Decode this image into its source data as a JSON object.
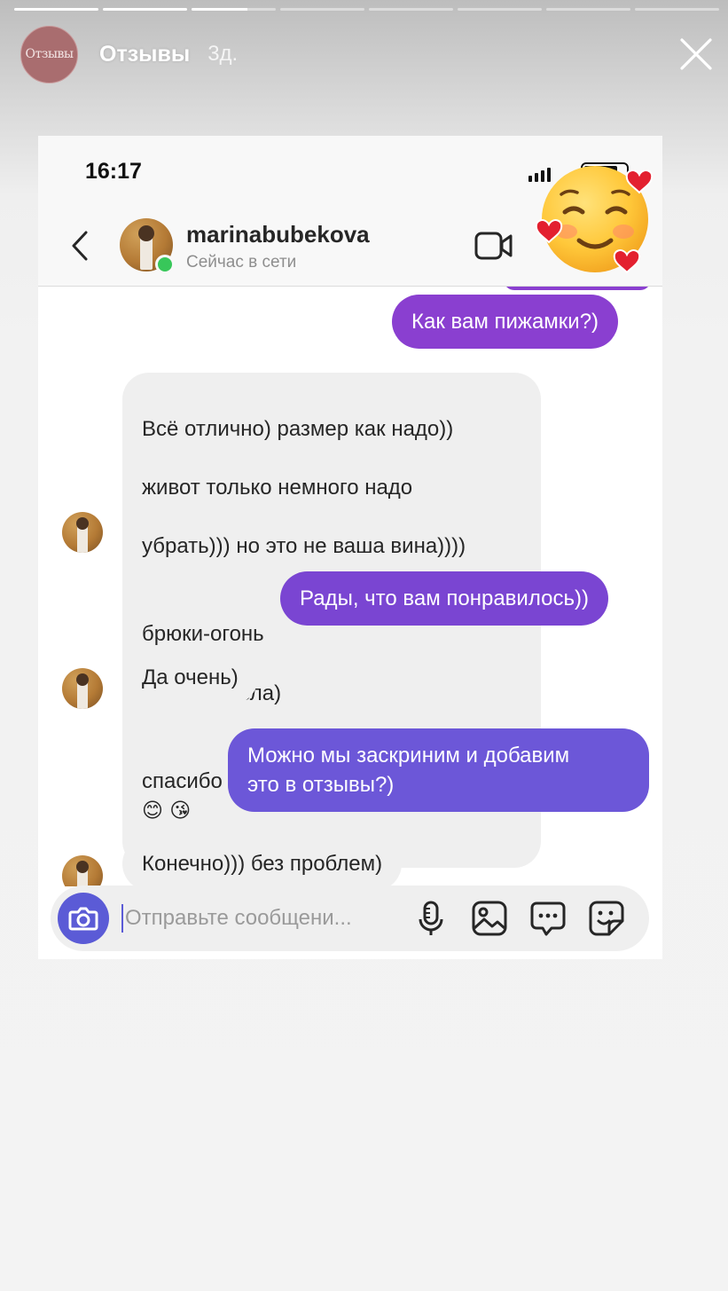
{
  "story": {
    "progress": [
      1,
      1,
      0.66,
      0,
      0,
      0,
      0,
      0
    ],
    "avatar_text": "Отзывы",
    "name": "Отзывы",
    "time": "3д.",
    "close_icon": "close-icon"
  },
  "screenshot": {
    "status_time": "16:17",
    "username": "marinabubekova",
    "presence": "Сейчас в сети",
    "sticker_icon": "smiling-face-with-hearts-icon",
    "messages": [
      {
        "dir": "out",
        "text": "Как вам пижамки?)",
        "color": "#8a3fd0"
      },
      {
        "dir": "in",
        "lines": [
          "Всё отлично) размер как надо))",
          "живот только немного надо",
          "убрать))) но это не ваша вина))))"
        ],
        "line4": "брюки-огонь",
        "line4_emoji": "👌",
        "line4_tail": " то что хотела)",
        "line5": "спасибо",
        "line5_emoji": "😊 😘"
      },
      {
        "dir": "out",
        "text": "Рады, что вам понравилось))",
        "color": "#7a45d2"
      },
      {
        "dir": "in",
        "text": "Да очень)"
      },
      {
        "dir": "out",
        "text": "Можно мы заскриним и добавим\nэто в отзывы?)",
        "color": "#6c57d8"
      },
      {
        "dir": "in",
        "text": "Конечно))) без проблем)"
      }
    ],
    "composer": {
      "placeholder": "Отправьте сообщени..."
    },
    "colors": {
      "accent": "#5b5bd6",
      "online": "#38c75a",
      "incoming_bubble": "#efefef"
    }
  }
}
